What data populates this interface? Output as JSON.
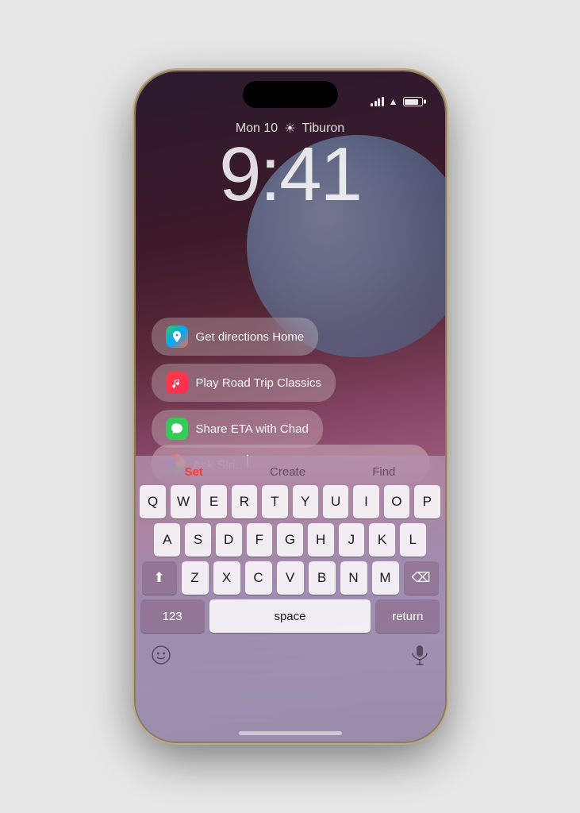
{
  "phone": {
    "status_bar": {
      "signal_label": "Signal",
      "wifi_label": "WiFi",
      "battery_label": "Battery"
    },
    "lock_screen": {
      "date": "Mon 10",
      "location": "Tiburon",
      "time": "9:41"
    },
    "suggestions": [
      {
        "id": "directions",
        "icon": "🗺",
        "icon_type": "maps",
        "text": "Get directions Home"
      },
      {
        "id": "music",
        "icon": "♫",
        "icon_type": "music",
        "text": "Play Road Trip Classics"
      },
      {
        "id": "messages",
        "icon": "💬",
        "icon_type": "messages",
        "text": "Share ETA with Chad"
      }
    ],
    "siri_input": {
      "placeholder": "Ask Siri..."
    },
    "siri_modes": [
      {
        "label": "Set",
        "active": true
      },
      {
        "label": "Create",
        "active": false
      },
      {
        "label": "Find",
        "active": false
      }
    ],
    "keyboard": {
      "rows": [
        [
          "Q",
          "W",
          "E",
          "R",
          "T",
          "Y",
          "U",
          "I",
          "O",
          "P"
        ],
        [
          "A",
          "S",
          "D",
          "F",
          "G",
          "H",
          "J",
          "K",
          "L"
        ],
        [
          "⇧",
          "Z",
          "X",
          "C",
          "V",
          "B",
          "N",
          "M",
          "⌫"
        ],
        [
          "123",
          "space",
          "return"
        ]
      ]
    },
    "bottom": {
      "emoji_label": "Emoji",
      "mic_label": "Microphone"
    }
  }
}
